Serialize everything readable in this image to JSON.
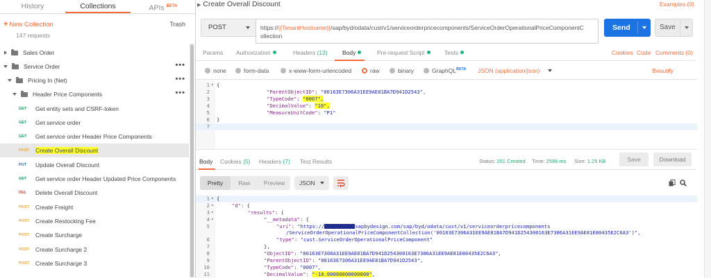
{
  "sidebar": {
    "tabs": [
      {
        "label": "History",
        "badge": ""
      },
      {
        "label": "Collections",
        "badge": ""
      },
      {
        "label": "APIs",
        "badge": "BETA"
      }
    ],
    "new_collection": "New Collection",
    "trash": "Trash",
    "request_count": "147 requests",
    "tree": [
      {
        "type": "folder",
        "label": "Sales Order"
      },
      {
        "type": "folder",
        "label": "Service Order"
      },
      {
        "type": "folder",
        "label": "Pricing In (Net)"
      },
      {
        "type": "folder",
        "label": "Header Price Components"
      },
      {
        "type": "request",
        "method": "GET",
        "label": "Get entity sets and CSRF-token"
      },
      {
        "type": "request",
        "method": "GET",
        "label": "Get service order"
      },
      {
        "type": "request",
        "method": "GET",
        "label": "Get service order Header Price Components"
      },
      {
        "type": "request",
        "method": "POST",
        "label": "Create Overall Discount",
        "selected": true
      },
      {
        "type": "request",
        "method": "PUT",
        "label": "Update Overall Discount"
      },
      {
        "type": "request",
        "method": "GET",
        "label": "Get service order Header Updated Price Components"
      },
      {
        "type": "request",
        "method": "DEL",
        "label": "Delete Overall Discount"
      },
      {
        "type": "request",
        "method": "POST",
        "label": "Create Freight"
      },
      {
        "type": "request",
        "method": "POST",
        "label": "Create Restocking Fee"
      },
      {
        "type": "request",
        "method": "POST",
        "label": "Create Surcharge"
      },
      {
        "type": "request",
        "method": "POST",
        "label": "Create Surcharge 2"
      },
      {
        "type": "request",
        "method": "POST",
        "label": "Create Surcharge 3"
      }
    ]
  },
  "request": {
    "title": "Create Overall Discount",
    "examples": "Examples (0)",
    "method": "POST",
    "url_prefix": "https://",
    "url_var": "{{TenantHostname}}",
    "url_suffix": "/sap/byd/odata/cust/v1/serviceorderpricecomponents/ServiceOrderOperationalPriceComponentC",
    "url_line2": "ollection",
    "send": "Send",
    "save": "Save",
    "tabs": {
      "params": "Params",
      "authorization": "Authorization",
      "headers": "Headers",
      "headers_count": "(12)",
      "body": "Body",
      "prerequest": "Pre-request Script",
      "tests": "Tests"
    },
    "cookies": "Cookies",
    "code": "Code",
    "comments": "Comments (0)",
    "body_types": {
      "none": "none",
      "form_data": "form-data",
      "urlencoded": "x-www-form-urlencoded",
      "raw": "raw",
      "binary": "binary",
      "graphql": "GraphQL",
      "graphql_badge": "BETA"
    },
    "content_type": "JSON (application/json)",
    "beautify": "Beautify",
    "code_lines": [
      {
        "n": "1",
        "fold": "▾",
        "text": "{"
      },
      {
        "n": "2",
        "fold": "",
        "key": "\"ParentObjectID\"",
        "sep": ": ",
        "val": "\"00163E7306A31EE9AE81BA7D941D2543\"",
        "tail": ",",
        "hl": false
      },
      {
        "n": "3",
        "fold": "",
        "key": "\"TypeCode\"",
        "sep": ": ",
        "val": "\"0007\"",
        "tail": ",",
        "hl": true
      },
      {
        "n": "4",
        "fold": "",
        "key": "\"DecimalValue\"",
        "sep": ": ",
        "val": "\"10\"",
        "tail": ",",
        "hl": true
      },
      {
        "n": "5",
        "fold": "",
        "key": "\"MeasureUnitCode\"",
        "sep": ": ",
        "val": "\"P1\"",
        "tail": "",
        "hl": false
      },
      {
        "n": "6",
        "fold": "",
        "text": "}"
      },
      {
        "n": "7",
        "fold": "",
        "text": ""
      }
    ]
  },
  "response": {
    "tabs": {
      "body": "Body",
      "cookies": "Cookies",
      "cookies_count": "(5)",
      "headers": "Headers",
      "headers_count": "(7)",
      "tests": "Test Results"
    },
    "status_label": "Status:",
    "status_value": "201 Created",
    "time_label": "Time:",
    "time_value": "2596 ms",
    "size_label": "Size:",
    "size_value": "1.25 KB",
    "save": "Save",
    "download": "Download",
    "views": {
      "pretty": "Pretty",
      "raw": "Raw",
      "preview": "Preview"
    },
    "format": "JSON",
    "code_lines": [
      {
        "n": "1",
        "fold": "▾",
        "indent": 0,
        "text": "{"
      },
      {
        "n": "2",
        "fold": "▾",
        "indent": 1,
        "key": "\"d\"",
        "rest": ": {"
      },
      {
        "n": "3",
        "fold": "▾",
        "indent": 2,
        "key": "\"results\"",
        "rest": ": {"
      },
      {
        "n": "4",
        "fold": "▾",
        "indent": 3,
        "key": "\"__metadata\"",
        "rest": ": {"
      },
      {
        "n": "5",
        "fold": "",
        "indent": 4,
        "key": "\"uri\"",
        "rest": ": ",
        "val_a": "\"https://",
        "val_b": "sapbydesign.com/sap/byd/odata/cust/v1/serviceorderpricecomponents"
      },
      {
        "n": "",
        "fold": "",
        "indent": 5,
        "val": "/ServiceOrderOperationalPriceComponentCollection('00163E7306A31EE9AE81BA7D941D254300163E7306A31EE9AE81E80435E2C6A3')\","
      },
      {
        "n": "6",
        "fold": "",
        "indent": 4,
        "key": "\"type\"",
        "rest": ": ",
        "val": "\"cust.ServiceOrderOperationalPriceComponent\""
      },
      {
        "n": "7",
        "fold": "",
        "indent": 3,
        "text": "},"
      },
      {
        "n": "8",
        "fold": "",
        "indent": 3,
        "key": "\"ObjectID\"",
        "rest": ": ",
        "val": "\"00163E7306A31EE9AE81BA7D941D254300163E7306A31EE9AE81E80435E2C6A3\","
      },
      {
        "n": "9",
        "fold": "",
        "indent": 3,
        "key": "\"ParentObjectID\"",
        "rest": ": ",
        "val": "\"00163E7306A31EE9AE81BA7D941D2543\","
      },
      {
        "n": "10",
        "fold": "",
        "indent": 3,
        "key": "\"TypeCode\"",
        "rest": ": ",
        "val": "\"0007\","
      },
      {
        "n": "11",
        "fold": "",
        "indent": 3,
        "key": "\"DecimalValue\"",
        "rest": ": ",
        "val_hl": "\"-10.00000000000000\"",
        "tail": ","
      }
    ]
  },
  "colors": {
    "accent": "#f26b3a",
    "send": "#1c74e4",
    "ok": "#1fa76b",
    "highlight": "#ffff2e"
  }
}
